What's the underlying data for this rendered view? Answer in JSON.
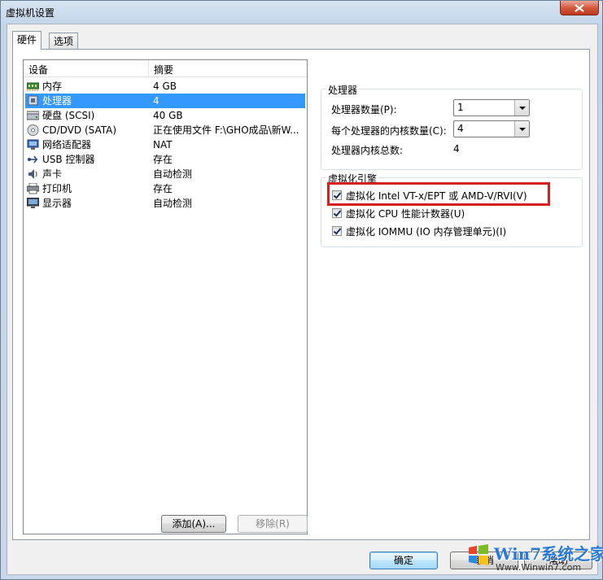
{
  "window": {
    "title": "虚拟机设置"
  },
  "tabs": [
    {
      "label": "硬件"
    },
    {
      "label": "选项"
    }
  ],
  "device_list": {
    "headers": {
      "device": "设备",
      "summary": "摘要"
    },
    "rows": [
      {
        "icon": "memory-icon",
        "device": "内存",
        "summary": "4 GB"
      },
      {
        "icon": "processor-icon",
        "device": "处理器",
        "summary": "4"
      },
      {
        "icon": "hard-disk-icon",
        "device": "硬盘 (SCSI)",
        "summary": "40 GB"
      },
      {
        "icon": "cd-dvd-icon",
        "device": "CD/DVD (SATA)",
        "summary": "正在使用文件 F:\\GHO成品\\新W..."
      },
      {
        "icon": "network-adapter-icon",
        "device": "网络适配器",
        "summary": "NAT"
      },
      {
        "icon": "usb-icon",
        "device": "USB 控制器",
        "summary": "存在"
      },
      {
        "icon": "sound-card-icon",
        "device": "声卡",
        "summary": "自动检测"
      },
      {
        "icon": "printer-icon",
        "device": "打印机",
        "summary": "存在"
      },
      {
        "icon": "display-icon",
        "device": "显示器",
        "summary": "自动检测"
      }
    ],
    "selected_index": 1
  },
  "list_buttons": {
    "add": "添加(A)...",
    "remove": "移除(R)"
  },
  "processor": {
    "title": "处理器",
    "count_label": "处理器数量(P):",
    "count_value": "1",
    "cores_label": "每个处理器的内核数量(C):",
    "cores_value": "4",
    "total_label": "处理器内核总数:",
    "total_value": "4"
  },
  "virtualization": {
    "title": "虚拟化引擎",
    "options": [
      {
        "label": "虚拟化 Intel VT-x/EPT 或 AMD-V/RVI(V)",
        "checked": true
      },
      {
        "label": "虚拟化 CPU 性能计数器(U)",
        "checked": true
      },
      {
        "label": "虚拟化 IOMMU (IO 内存管理单元)(I)",
        "checked": true
      }
    ]
  },
  "footer": {
    "ok": "确定",
    "cancel": "取消",
    "help": "帮助"
  },
  "watermark": {
    "text": "Win7系统之家",
    "url_text": "Www.Winwin7.com"
  },
  "colors": {
    "selection": "#3399ff",
    "highlight_border": "#d42020"
  }
}
